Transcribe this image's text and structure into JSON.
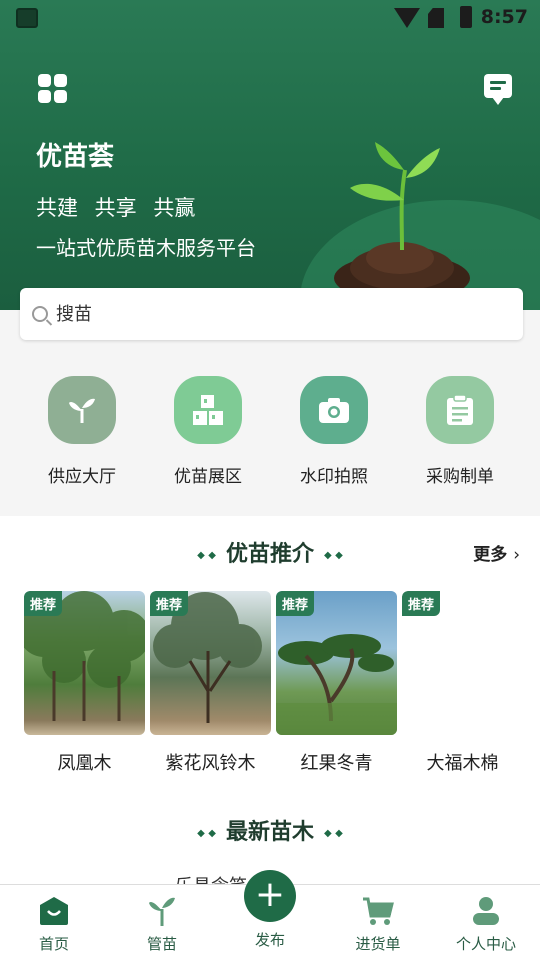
{
  "status_bar": {
    "time": "8:57"
  },
  "header": {
    "brand": "优苗荟",
    "slogan": "共建 共享 共赢",
    "tagline": "一站式优质苗木服务平台"
  },
  "search": {
    "placeholder": "搜苗"
  },
  "quick_actions": [
    {
      "label": "供应大厅",
      "icon": "sprout-icon",
      "color": "#8faf94"
    },
    {
      "label": "优苗展区",
      "icon": "boxes-icon",
      "color": "#7fcb95"
    },
    {
      "label": "水印拍照",
      "icon": "camera-icon",
      "color": "#5eae8e"
    },
    {
      "label": "采购制单",
      "icon": "clipboard-icon",
      "color": "#94c9a1"
    }
  ],
  "recommend": {
    "title": "优苗推介",
    "more": "更多",
    "badge": "推荐",
    "items": [
      {
        "name": "凤凰木"
      },
      {
        "name": "紫花风铃木"
      },
      {
        "name": "红果冬青"
      },
      {
        "name": "大福木棉"
      }
    ]
  },
  "latest": {
    "title": "最新苗木",
    "peek": "乐昌含笑"
  },
  "bottom_nav": [
    {
      "label": "首页",
      "active": true
    },
    {
      "label": "管苗"
    },
    {
      "label": "发布"
    },
    {
      "label": "进货单"
    },
    {
      "label": "个人中心"
    }
  ],
  "colors": {
    "primary": "#1f6b47",
    "accent": "#2a7a55"
  }
}
